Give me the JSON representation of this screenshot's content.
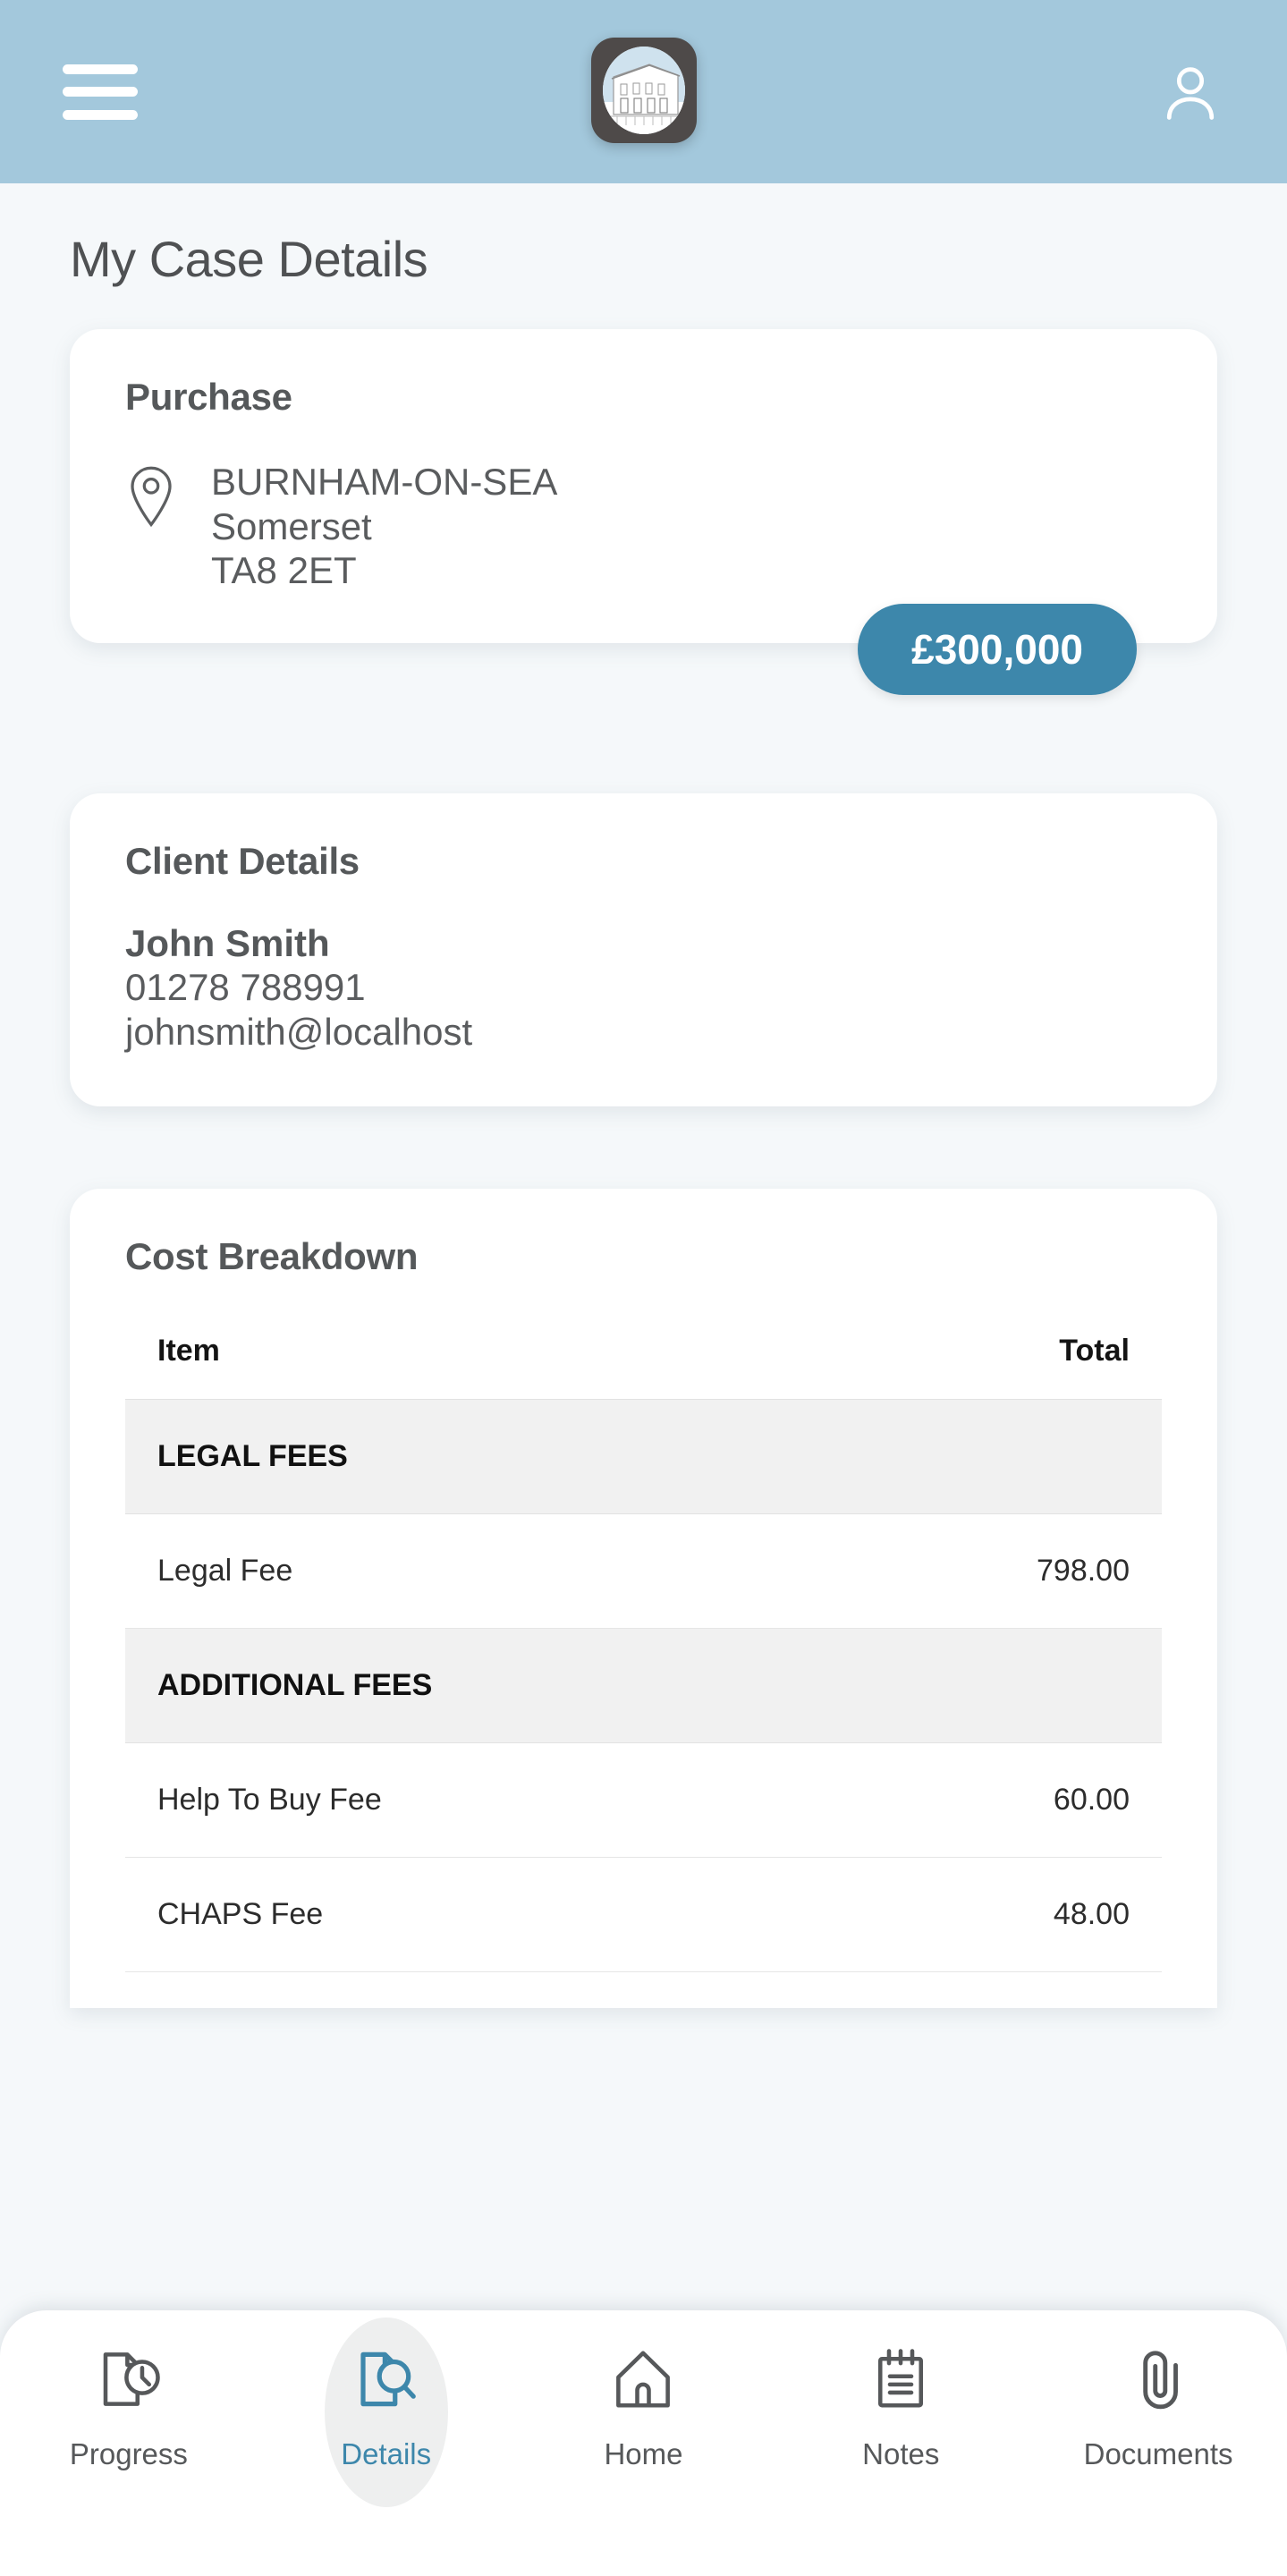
{
  "header": {
    "menu_label": "Menu",
    "logo_name": "georgian-house-logo",
    "profile_label": "Profile"
  },
  "page": {
    "title": "My Case Details"
  },
  "purchase_card": {
    "title": "Purchase",
    "address_line1": "BURNHAM-ON-SEA",
    "address_line2": "Somerset",
    "address_line3": "TA8 2ET",
    "price": "£300,000",
    "price_color": "#3d87ab"
  },
  "client_card": {
    "title": "Client Details",
    "name": "John Smith",
    "phone": "01278 788991",
    "email": "johnsmith@localhost"
  },
  "cost_card": {
    "title": "Cost Breakdown",
    "columns": {
      "item": "Item",
      "total": "Total"
    },
    "rows": [
      {
        "type": "section",
        "label": "LEGAL FEES",
        "amount": ""
      },
      {
        "type": "fee",
        "label": "Legal Fee",
        "amount": "798.00"
      },
      {
        "type": "section",
        "label": "ADDITIONAL FEES",
        "amount": ""
      },
      {
        "type": "fee",
        "label": "Help To Buy Fee",
        "amount": "60.00"
      },
      {
        "type": "fee",
        "label": "CHAPS Fee",
        "amount": "48.00"
      }
    ]
  },
  "bottom_nav": {
    "active": "Details",
    "active_color": "#3d87ab",
    "items": [
      {
        "label": "Progress",
        "icon": "document-clock-icon"
      },
      {
        "label": "Details",
        "icon": "document-search-icon"
      },
      {
        "label": "Home",
        "icon": "home-icon"
      },
      {
        "label": "Notes",
        "icon": "notepad-icon"
      },
      {
        "label": "Documents",
        "icon": "paperclip-icon"
      }
    ]
  }
}
